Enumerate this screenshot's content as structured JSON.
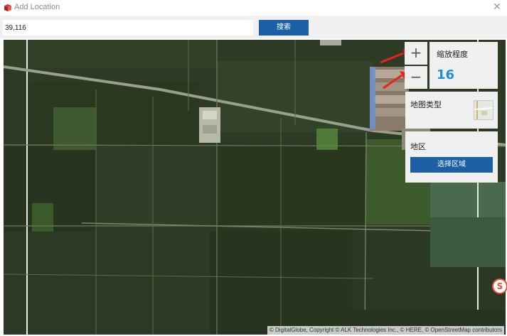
{
  "window": {
    "title": "Add Location",
    "close_icon": "close-icon"
  },
  "search": {
    "value": "39,116",
    "button_label": "搜索"
  },
  "map_controls": {
    "zoom_in_label": "+",
    "zoom_out_label": "−",
    "zoom_label": "缩放程度",
    "zoom_value": "16",
    "map_type_label": "地图类型",
    "region_label": "地区",
    "region_button_label": "选择区域"
  },
  "attribution": "© DigitalGlobe, Copyright © ALK Technologies Inc., © HERE, © OpenStreetMap contributors",
  "colors": {
    "accent": "#1b5fa5",
    "zoom_value": "#1e8ed6",
    "arrow": "#e8231b"
  }
}
